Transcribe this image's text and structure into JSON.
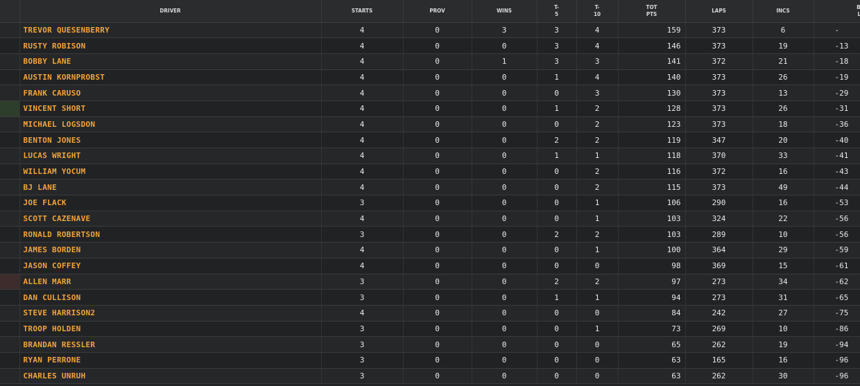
{
  "columns": [
    "",
    "DRIVER",
    "STARTS",
    "PROV",
    "WINS",
    "T-\n5",
    "T-\n10",
    "TOT\nPTS",
    "LAPS",
    "INCS",
    "BEH\nLEA"
  ],
  "rows": [
    {
      "driver": "TREVOR QUESENBERRY",
      "starts": "4",
      "prov": "0",
      "wins": "3",
      "t5": "3",
      "t10": "4",
      "pts": "159",
      "laps": "373",
      "incs": "6",
      "behind": "-",
      "marker": ""
    },
    {
      "driver": "RUSTY ROBISON",
      "starts": "4",
      "prov": "0",
      "wins": "0",
      "t5": "3",
      "t10": "4",
      "pts": "146",
      "laps": "373",
      "incs": "19",
      "behind": "-13",
      "marker": ""
    },
    {
      "driver": "BOBBY LANE",
      "starts": "4",
      "prov": "0",
      "wins": "1",
      "t5": "3",
      "t10": "3",
      "pts": "141",
      "laps": "372",
      "incs": "21",
      "behind": "-18",
      "marker": ""
    },
    {
      "driver": "AUSTIN KORNPROBST",
      "starts": "4",
      "prov": "0",
      "wins": "0",
      "t5": "1",
      "t10": "4",
      "pts": "140",
      "laps": "373",
      "incs": "26",
      "behind": "-19",
      "marker": ""
    },
    {
      "driver": "FRANK CARUSO",
      "starts": "4",
      "prov": "0",
      "wins": "0",
      "t5": "0",
      "t10": "3",
      "pts": "130",
      "laps": "373",
      "incs": "13",
      "behind": "-29",
      "marker": ""
    },
    {
      "driver": "VINCENT SHORT",
      "starts": "4",
      "prov": "0",
      "wins": "0",
      "t5": "1",
      "t10": "2",
      "pts": "128",
      "laps": "373",
      "incs": "26",
      "behind": "-31",
      "marker": "green"
    },
    {
      "driver": "MICHAEL LOGSDON",
      "starts": "4",
      "prov": "0",
      "wins": "0",
      "t5": "0",
      "t10": "2",
      "pts": "123",
      "laps": "373",
      "incs": "18",
      "behind": "-36",
      "marker": ""
    },
    {
      "driver": "BENTON JONES",
      "starts": "4",
      "prov": "0",
      "wins": "0",
      "t5": "2",
      "t10": "2",
      "pts": "119",
      "laps": "347",
      "incs": "20",
      "behind": "-40",
      "marker": ""
    },
    {
      "driver": "LUCAS WRIGHT",
      "starts": "4",
      "prov": "0",
      "wins": "0",
      "t5": "1",
      "t10": "1",
      "pts": "118",
      "laps": "370",
      "incs": "33",
      "behind": "-41",
      "marker": ""
    },
    {
      "driver": "WILLIAM YOCUM",
      "starts": "4",
      "prov": "0",
      "wins": "0",
      "t5": "0",
      "t10": "2",
      "pts": "116",
      "laps": "372",
      "incs": "16",
      "behind": "-43",
      "marker": ""
    },
    {
      "driver": "BJ LANE",
      "starts": "4",
      "prov": "0",
      "wins": "0",
      "t5": "0",
      "t10": "2",
      "pts": "115",
      "laps": "373",
      "incs": "49",
      "behind": "-44",
      "marker": ""
    },
    {
      "driver": "JOE FLACK",
      "starts": "3",
      "prov": "0",
      "wins": "0",
      "t5": "0",
      "t10": "1",
      "pts": "106",
      "laps": "290",
      "incs": "16",
      "behind": "-53",
      "marker": ""
    },
    {
      "driver": "SCOTT CAZENAVE",
      "starts": "4",
      "prov": "0",
      "wins": "0",
      "t5": "0",
      "t10": "1",
      "pts": "103",
      "laps": "324",
      "incs": "22",
      "behind": "-56",
      "marker": ""
    },
    {
      "driver": "RONALD ROBERTSON",
      "starts": "3",
      "prov": "0",
      "wins": "0",
      "t5": "2",
      "t10": "2",
      "pts": "103",
      "laps": "289",
      "incs": "10",
      "behind": "-56",
      "marker": ""
    },
    {
      "driver": "JAMES BORDEN",
      "starts": "4",
      "prov": "0",
      "wins": "0",
      "t5": "0",
      "t10": "1",
      "pts": "100",
      "laps": "364",
      "incs": "29",
      "behind": "-59",
      "marker": ""
    },
    {
      "driver": "JASON COFFEY",
      "starts": "4",
      "prov": "0",
      "wins": "0",
      "t5": "0",
      "t10": "0",
      "pts": "98",
      "laps": "369",
      "incs": "15",
      "behind": "-61",
      "marker": ""
    },
    {
      "driver": "ALLEN MARR",
      "starts": "3",
      "prov": "0",
      "wins": "0",
      "t5": "2",
      "t10": "2",
      "pts": "97",
      "laps": "273",
      "incs": "34",
      "behind": "-62",
      "marker": "red"
    },
    {
      "driver": "DAN CULLISON",
      "starts": "3",
      "prov": "0",
      "wins": "0",
      "t5": "1",
      "t10": "1",
      "pts": "94",
      "laps": "273",
      "incs": "31",
      "behind": "-65",
      "marker": ""
    },
    {
      "driver": "STEVE HARRISON2",
      "starts": "4",
      "prov": "0",
      "wins": "0",
      "t5": "0",
      "t10": "0",
      "pts": "84",
      "laps": "242",
      "incs": "27",
      "behind": "-75",
      "marker": ""
    },
    {
      "driver": "TROOP HOLDEN",
      "starts": "3",
      "prov": "0",
      "wins": "0",
      "t5": "0",
      "t10": "1",
      "pts": "73",
      "laps": "269",
      "incs": "10",
      "behind": "-86",
      "marker": ""
    },
    {
      "driver": "BRANDAN RESSLER",
      "starts": "3",
      "prov": "0",
      "wins": "0",
      "t5": "0",
      "t10": "0",
      "pts": "65",
      "laps": "262",
      "incs": "19",
      "behind": "-94",
      "marker": ""
    },
    {
      "driver": "RYAN PERRONE",
      "starts": "3",
      "prov": "0",
      "wins": "0",
      "t5": "0",
      "t10": "0",
      "pts": "63",
      "laps": "165",
      "incs": "16",
      "behind": "-96",
      "marker": ""
    },
    {
      "driver": "CHARLES UNRUH",
      "starts": "3",
      "prov": "0",
      "wins": "0",
      "t5": "0",
      "t10": "0",
      "pts": "63",
      "laps": "262",
      "incs": "30",
      "behind": "-96",
      "marker": ""
    }
  ],
  "colors": {
    "driver_text": "#f2a43a",
    "marker_green": "#2d3e2c",
    "marker_red": "#3e2c2c"
  }
}
